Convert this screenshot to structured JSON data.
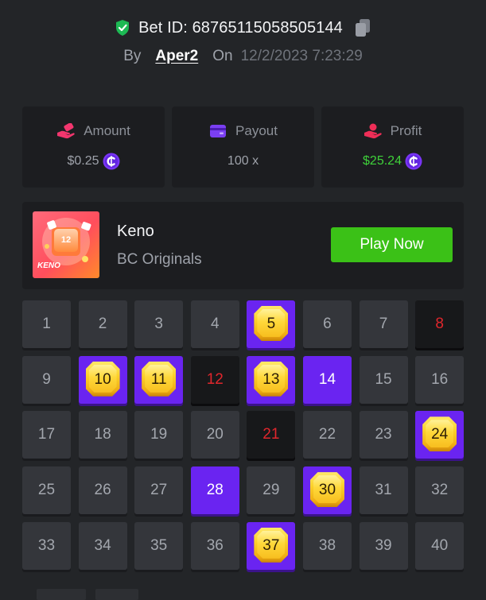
{
  "header": {
    "bet_id_label": "Bet ID: 68765115058505144",
    "by_label": "By",
    "username": "Aper2",
    "on_label": "On",
    "datetime": "12/2/2023 7:23:29",
    "icons": [
      "shield-check-icon",
      "copy-icon"
    ],
    "colors": {
      "verified": "#1db954"
    }
  },
  "stats": {
    "amount": {
      "label": "Amount",
      "value": "$0.25",
      "icon": "hand-coins-icon",
      "currency_icon": "coin-icon"
    },
    "payout": {
      "label": "Payout",
      "value": "100 x",
      "icon": "wallet-icon"
    },
    "profit": {
      "label": "Profit",
      "value": "$25.24",
      "icon": "hand-profit-icon",
      "currency_icon": "coin-icon",
      "color": "#3fd13a"
    }
  },
  "game": {
    "name": "Keno",
    "provider": "BC Originals",
    "thumbnail_number": "12",
    "thumbnail_label": "KENO",
    "play_button": "Play Now",
    "colors": {
      "play_button": "#3bc117"
    }
  },
  "keno": {
    "colors": {
      "picked": "#6a24f1",
      "miss_text": "#e0262c",
      "gem": "#fcd12a"
    },
    "cells": [
      {
        "n": "1",
        "state": "normal"
      },
      {
        "n": "2",
        "state": "normal"
      },
      {
        "n": "3",
        "state": "normal"
      },
      {
        "n": "4",
        "state": "normal"
      },
      {
        "n": "5",
        "state": "hit"
      },
      {
        "n": "6",
        "state": "normal"
      },
      {
        "n": "7",
        "state": "normal"
      },
      {
        "n": "8",
        "state": "miss"
      },
      {
        "n": "9",
        "state": "normal"
      },
      {
        "n": "10",
        "state": "hit"
      },
      {
        "n": "11",
        "state": "hit"
      },
      {
        "n": "12",
        "state": "miss"
      },
      {
        "n": "13",
        "state": "hit"
      },
      {
        "n": "14",
        "state": "picked"
      },
      {
        "n": "15",
        "state": "normal"
      },
      {
        "n": "16",
        "state": "normal"
      },
      {
        "n": "17",
        "state": "normal"
      },
      {
        "n": "18",
        "state": "normal"
      },
      {
        "n": "19",
        "state": "normal"
      },
      {
        "n": "20",
        "state": "normal"
      },
      {
        "n": "21",
        "state": "miss"
      },
      {
        "n": "22",
        "state": "normal"
      },
      {
        "n": "23",
        "state": "normal"
      },
      {
        "n": "24",
        "state": "hit"
      },
      {
        "n": "25",
        "state": "normal"
      },
      {
        "n": "26",
        "state": "normal"
      },
      {
        "n": "27",
        "state": "normal"
      },
      {
        "n": "28",
        "state": "picked"
      },
      {
        "n": "29",
        "state": "normal"
      },
      {
        "n": "30",
        "state": "hit"
      },
      {
        "n": "31",
        "state": "normal"
      },
      {
        "n": "32",
        "state": "normal"
      },
      {
        "n": "33",
        "state": "normal"
      },
      {
        "n": "34",
        "state": "normal"
      },
      {
        "n": "35",
        "state": "normal"
      },
      {
        "n": "36",
        "state": "normal"
      },
      {
        "n": "37",
        "state": "hit"
      },
      {
        "n": "38",
        "state": "normal"
      },
      {
        "n": "39",
        "state": "normal"
      },
      {
        "n": "40",
        "state": "normal"
      }
    ]
  }
}
